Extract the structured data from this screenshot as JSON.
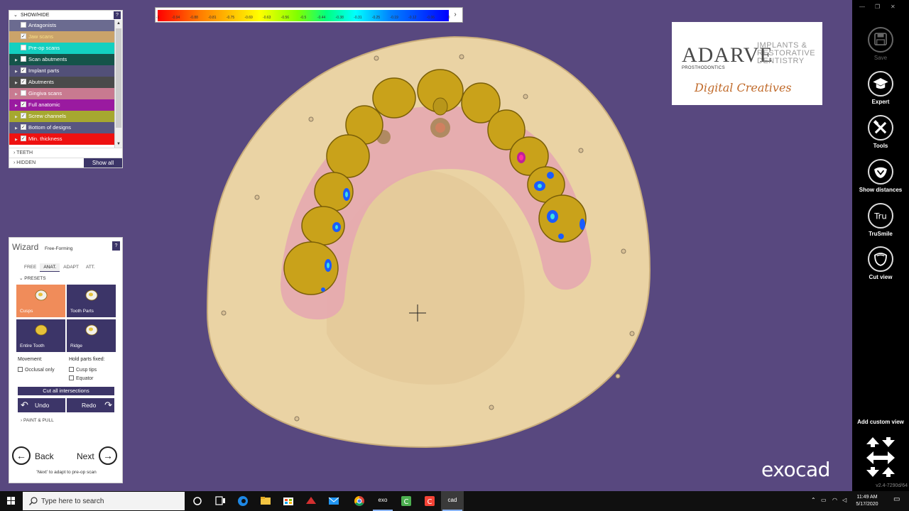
{
  "scale": {
    "ticks": [
      "-1",
      "-0.94",
      "-0.88",
      "-0.81",
      "-0.75",
      "-0.69",
      "-0.63",
      "-0.56",
      "-0.5",
      "-0.44",
      "-0.38",
      "-0.31",
      "-0.25",
      "-0.19",
      "-0.12",
      "-0.06",
      "0"
    ]
  },
  "showhide": {
    "header": "SHOW/HIDE",
    "help": "?",
    "layers": [
      {
        "label": "Antagonists",
        "checked": false,
        "color": "#6b6b90",
        "expand": false
      },
      {
        "label": "Jaw scans",
        "checked": true,
        "color": "#caa36a",
        "expand": false
      },
      {
        "label": "Pre-op scans",
        "checked": false,
        "color": "#13d0c0",
        "expand": false
      },
      {
        "label": "Scan abutments",
        "checked": false,
        "color": "#14544a",
        "expand": true
      },
      {
        "label": "Implant parts",
        "checked": true,
        "color": "#525078",
        "expand": true
      },
      {
        "label": "Abutments",
        "checked": true,
        "color": "#4a4a4a",
        "expand": true
      },
      {
        "label": "Gingiva scans",
        "checked": false,
        "color": "#c87a90",
        "expand": true
      },
      {
        "label": "Full anatomic",
        "checked": true,
        "color": "#9a1aa0",
        "expand": true
      },
      {
        "label": "Screw channels",
        "checked": true,
        "color": "#a6a830",
        "expand": true
      },
      {
        "label": "Bottom of designs",
        "checked": true,
        "color": "#585680",
        "expand": true
      },
      {
        "label": "Min. thickness",
        "checked": true,
        "color": "#ee1111",
        "expand": true
      }
    ],
    "teeth": "TEETH",
    "hidden": "HIDDEN",
    "show_all": "Show all"
  },
  "wizard": {
    "title": "Wizard",
    "subtitle": "Free-Forming",
    "help": "?",
    "tabs": [
      "FREE",
      "ANAT.",
      "ADAPT",
      "ATT."
    ],
    "active_tab": 1,
    "presets_header": "PRESETS",
    "presets": [
      "Cusps",
      "Tooth Parts",
      "Entire Tooth",
      "Ridge"
    ],
    "selected_preset": 0,
    "movement_label": "Movement:",
    "hold_label": "Hold parts fixed:",
    "occlusal_only": "Occlusal only",
    "cusp_tips": "Cusp tips",
    "equator": "Equator",
    "cut_all": "Cut all intersections",
    "undo": "Undo",
    "redo": "Redo",
    "paint_pull": "PAINT & PULL",
    "back": "Back",
    "next": "Next",
    "hint": "'Next' to adapt to pre-op scan"
  },
  "logo": {
    "brand": "ADARVE",
    "tagline1": "IMPLANTS & RESTORATIVE DENTISTRY",
    "tagline2": "PROSTHODONTICS",
    "tagline3": "Digital Creatives"
  },
  "watermark": "exocad",
  "rightbar": {
    "tools": [
      {
        "label": "Save",
        "icon": "save-icon",
        "enabled": false
      },
      {
        "label": "Expert",
        "icon": "graduation-cap-icon",
        "enabled": true
      },
      {
        "label": "Tools",
        "icon": "tools-icon",
        "enabled": true
      },
      {
        "label": "Show distances",
        "icon": "distances-icon",
        "enabled": true
      },
      {
        "label": "TruSmile",
        "icon": "trusmile-icon",
        "enabled": true
      },
      {
        "label": "Cut view",
        "icon": "cut-view-icon",
        "enabled": true
      }
    ],
    "add_custom_view": "Add custom view",
    "version": "v2.4-7290d/64"
  },
  "taskbar": {
    "search_placeholder": "Type here to search",
    "apps": [
      "task-view",
      "edge",
      "file-explorer",
      "store",
      "app-red",
      "mail",
      "chrome",
      "exo",
      "camtasia-green",
      "camtasia-red",
      "cad"
    ],
    "exo_label": "exo",
    "cad_label": "cad",
    "time": "11:49 AM",
    "date": "5/17/2020"
  }
}
